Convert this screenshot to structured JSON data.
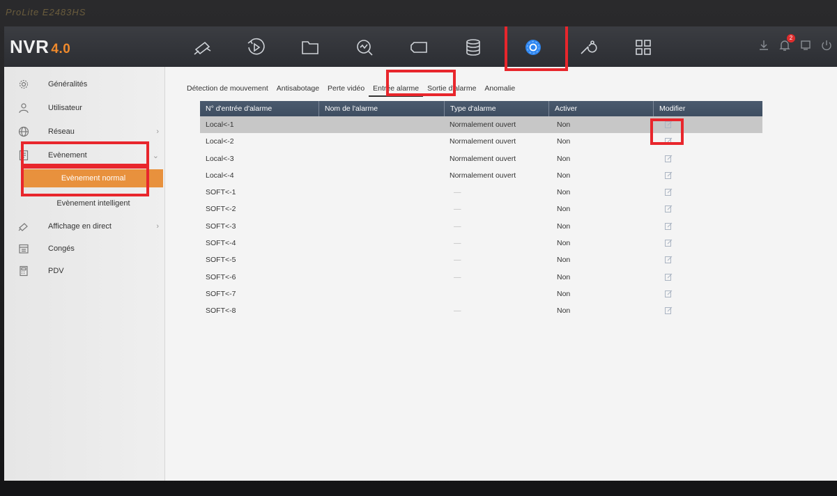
{
  "brand_text": "ProLite E2483HS",
  "app": {
    "logo": "NVR",
    "version": "4.0"
  },
  "topnav": {
    "icons": [
      "live-view-camera-icon",
      "playback-icon",
      "file-folder-icon",
      "smart-analysis-icon",
      "camera-management-icon",
      "storage-icon",
      "configuration-gear-icon",
      "maintenance-wrench-icon",
      "grid-apps-icon"
    ],
    "active": "configuration-gear-icon",
    "notification_count": "2"
  },
  "sidebar": {
    "items": [
      {
        "label": "Généralités",
        "icon": "general-settings-icon",
        "has_chevron": false
      },
      {
        "label": "Utilisateur",
        "icon": "user-icon",
        "has_chevron": false
      },
      {
        "label": "Réseau",
        "icon": "network-globe-icon",
        "has_chevron": true
      },
      {
        "label": "Evènement",
        "icon": "event-icon",
        "has_chevron": true,
        "expanded": true
      },
      {
        "label": "Affichage en direct",
        "icon": "live-view-icon",
        "has_chevron": true
      },
      {
        "label": "Congés",
        "icon": "holiday-calendar-icon",
        "has_chevron": false
      },
      {
        "label": "PDV",
        "icon": "pos-terminal-icon",
        "has_chevron": false
      }
    ],
    "sub_items": [
      {
        "label": "Evènement normal",
        "active": true
      },
      {
        "label": "Evènement intelligent",
        "active": false
      }
    ]
  },
  "tabs": [
    {
      "label": "Détection de mouvement",
      "active": false
    },
    {
      "label": "Antisabotage",
      "active": false
    },
    {
      "label": "Perte vidéo",
      "active": false
    },
    {
      "label": "Entrée alarme",
      "active": true
    },
    {
      "label": "Sortie d'alarme",
      "active": false
    },
    {
      "label": "Anomalie",
      "active": false
    }
  ],
  "table": {
    "columns": [
      "N° d'entrée d'alarme",
      "Nom de l'alarme",
      "Type d'alarme",
      "Activer",
      "Modifier"
    ],
    "rows": [
      {
        "id": "Local<-1",
        "name": "",
        "type": "Normalement ouvert",
        "enabled": "Non",
        "selected": true
      },
      {
        "id": "Local<-2",
        "name": "",
        "type": "Normalement ouvert",
        "enabled": "Non"
      },
      {
        "id": "Local<-3",
        "name": "",
        "type": "Normalement ouvert",
        "enabled": "Non"
      },
      {
        "id": "Local<-4",
        "name": "",
        "type": "Normalement ouvert",
        "enabled": "Non"
      },
      {
        "id": "SOFT<-1",
        "name": "",
        "type": "—",
        "enabled": "Non"
      },
      {
        "id": "SOFT<-2",
        "name": "",
        "type": "—",
        "enabled": "Non"
      },
      {
        "id": "SOFT<-3",
        "name": "",
        "type": "—",
        "enabled": "Non"
      },
      {
        "id": "SOFT<-4",
        "name": "",
        "type": "—",
        "enabled": "Non"
      },
      {
        "id": "SOFT<-5",
        "name": "",
        "type": "—",
        "enabled": "Non"
      },
      {
        "id": "SOFT<-6",
        "name": "",
        "type": "—",
        "enabled": "Non"
      },
      {
        "id": "SOFT<-7",
        "name": "",
        "type": "",
        "enabled": "Non"
      },
      {
        "id": "SOFT<-8",
        "name": "",
        "type": "—",
        "enabled": "Non"
      }
    ]
  },
  "colors": {
    "accent_orange": "#e8913d",
    "highlight_red": "#e8262c",
    "header_blue": "#44546a",
    "active_gear_blue": "#2e86f0"
  }
}
